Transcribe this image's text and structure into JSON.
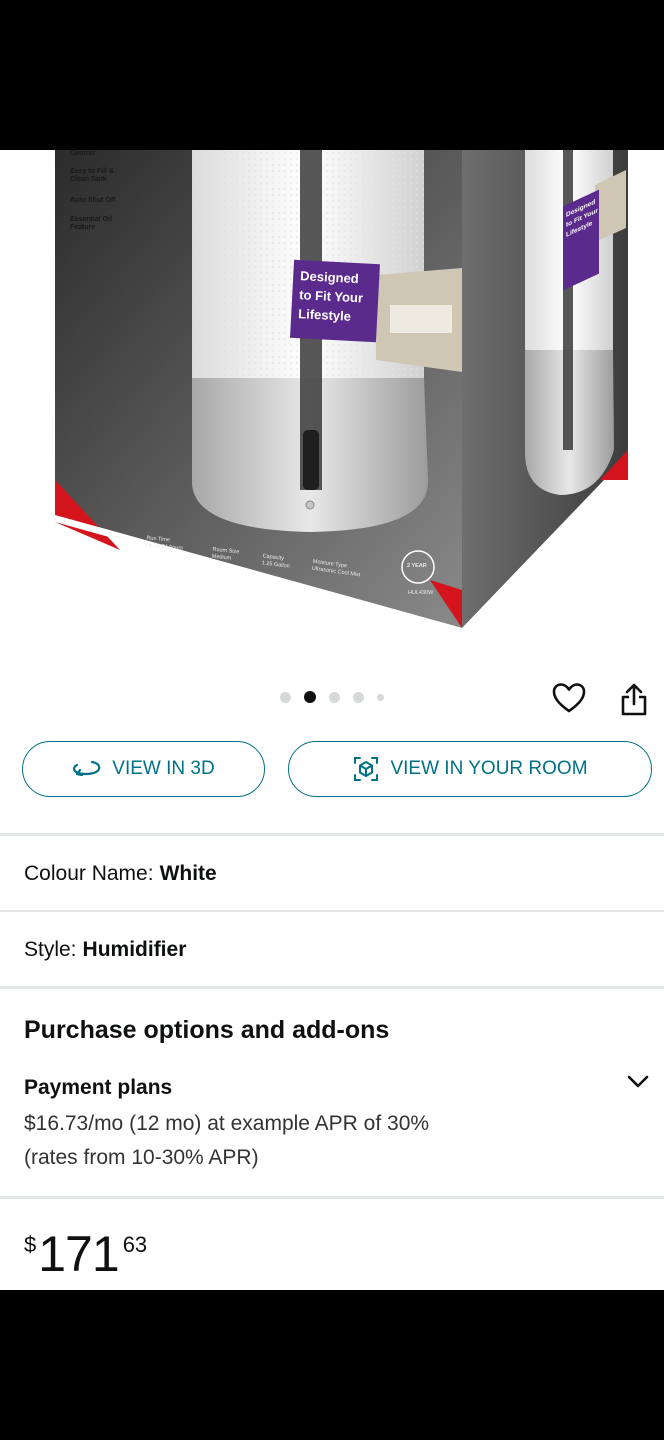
{
  "product_image": {
    "box_left_features": [
      "Control",
      "Easy to Fill &\nClean Tank",
      "Auto Shut Off",
      "Essential Oil\nFeature"
    ],
    "purple_tag": "Designed\nto Fit Your\nLifestyle",
    "purple_tag_side": "Designed\nto Fit Your\nLifestyle",
    "specs": [
      "Run Time\nUp To 24 hours",
      "Room Size\nMedium",
      "Capacity\n1.25 Gallon",
      "Moisture Type\nUltrasonic Cool Mist"
    ],
    "warranty_badge": "2 YEAR",
    "model_code": "HUL430W",
    "colors": {
      "box_dark": "#3a3a3a",
      "accent_red": "#d4141c",
      "tag_purple": "#5a2a8c"
    }
  },
  "carousel": {
    "total": 5,
    "active_index": 1
  },
  "actions": {
    "favorite_icon": "heart-icon",
    "share_icon": "share-icon"
  },
  "buttons": {
    "view_3d": "VIEW IN 3D",
    "view_room": "VIEW IN YOUR ROOM"
  },
  "variations": {
    "colour_label": "Colour Name:",
    "colour_value": "White",
    "style_label": "Style:",
    "style_value": "Humidifier"
  },
  "purchase": {
    "section_title": "Purchase options and add-ons",
    "payment_plans_title": "Payment plans",
    "payment_line1": "$16.73/mo (12 mo) at example APR of 30%",
    "payment_line2": "(rates from 10-30% APR)"
  },
  "price": {
    "symbol": "$",
    "whole": "171",
    "fraction": "63"
  },
  "theme": {
    "link_teal": "#007185",
    "text": "#0f1111",
    "divider": "#e3e6e6"
  }
}
